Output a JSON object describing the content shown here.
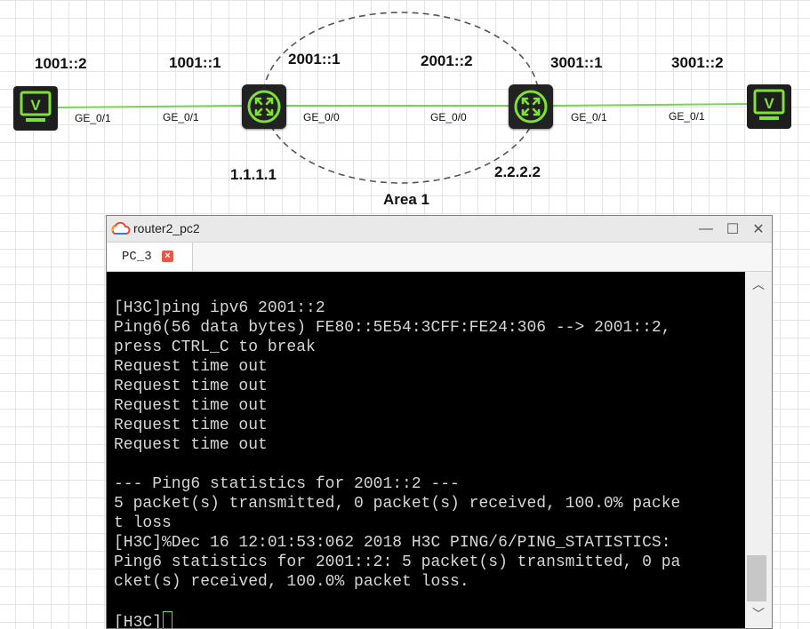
{
  "topology": {
    "area_label": "Area 1",
    "routers": [
      {
        "id": "router1",
        "router_id": "1.1.1.1"
      },
      {
        "id": "router2",
        "router_id": "2.2.2.2"
      }
    ],
    "pcs": [
      {
        "id": "pc-left",
        "glyph": "V"
      },
      {
        "id": "pc-right",
        "glyph": "V"
      }
    ],
    "addresses": {
      "pc_left": "1001::2",
      "r1_left": "1001::1",
      "r1_right": "2001::1",
      "r2_left": "2001::2",
      "r2_right": "3001::1",
      "pc_right": "3001::2"
    },
    "ports": {
      "pc_left": "GE_0/1",
      "r1_left": "GE_0/1",
      "r1_right": "GE_0/0",
      "r2_left": "GE_0/0",
      "r2_right": "GE_0/1",
      "pc_right": "GE_0/1"
    },
    "link_color": "#79d35b",
    "icon_color": "#7fe036"
  },
  "window": {
    "title": "router2_pc2",
    "controls": {
      "minimize": "—",
      "maximize": "☐",
      "close": "✕"
    },
    "tab": {
      "label": "PC_3",
      "close_glyph": "×"
    },
    "terminal": {
      "lines": [
        "[H3C]ping ipv6 2001::2",
        "Ping6(56 data bytes) FE80::5E54:3CFF:FE24:306 --> 2001::2,",
        "press CTRL_C to break",
        "Request time out",
        "Request time out",
        "Request time out",
        "Request time out",
        "Request time out",
        "",
        "--- Ping6 statistics for 2001::2 ---",
        "5 packet(s) transmitted, 0 packet(s) received, 100.0% packe",
        "t loss",
        "[H3C]%Dec 16 12:01:53:062 2018 H3C PING/6/PING_STATISTICS:",
        "Ping6 statistics for 2001::2: 5 packet(s) transmitted, 0 pa",
        "cket(s) received, 100.0% packet loss.",
        ""
      ],
      "prompt": "[H3C]"
    },
    "scroll_arrows": {
      "up": "︿",
      "down": "﹀"
    }
  }
}
